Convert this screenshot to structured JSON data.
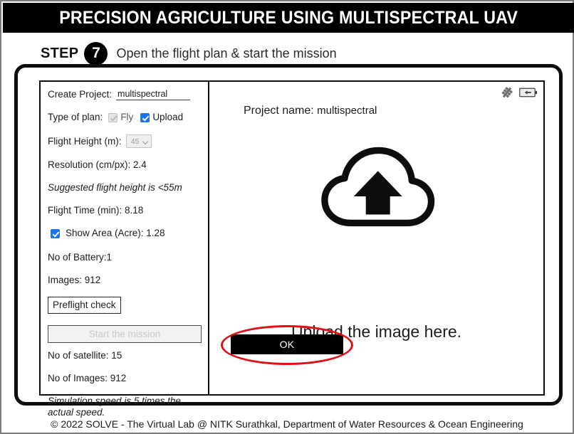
{
  "header": {
    "title": "PRECISION AGRICULTURE USING MULTISPECTRAL UAV"
  },
  "step": {
    "word": "STEP",
    "number": "7",
    "description": "Open the flight plan & start the mission"
  },
  "left_panel": {
    "create_project_label": "Create Project:",
    "project_name_value": "multispectral",
    "project_name_placeholder": "Project name",
    "type_of_plan_label": "Type of plan:",
    "fly_label": "Fly",
    "fly_checked": true,
    "fly_disabled": true,
    "upload_label": "Upload",
    "upload_checked": true,
    "flight_height_label": "Flight Height (m):",
    "flight_height_value": "45",
    "flight_height_options": [
      "45"
    ],
    "resolution_label": "Resolution (cm/px): 2.4",
    "suggested_height_note": "Suggested flight height is <55m",
    "flight_time_label": "Flight Time (min): 8.18",
    "show_area_label": "Show Area (Acre): 1.28",
    "show_area_checked": true,
    "no_of_battery_label": "No of Battery:1",
    "images_label": "Images: 912",
    "preflight_check_button": "Preflight check",
    "start_mission_button": "Start the mission",
    "start_mission_disabled": true,
    "no_of_satellite_label": "No of satellite: 15",
    "no_of_images_label": "No of Images: 912",
    "simulation_note": "Simulation speed is 5 times the actual speed."
  },
  "right_panel": {
    "project_name_label": "Project name:",
    "project_name_value": "multispectral",
    "upload_prompt": "Upload the image here.",
    "ok_button": "OK",
    "satellite_icon": "satellite-icon",
    "battery_icon": "battery-icon",
    "cloud_upload_icon": "cloud-upload-icon"
  },
  "annotation": {
    "highlight_color": "#e10f16",
    "target": "ok-button"
  },
  "footer": {
    "text": "© 2022 SOLVE - The Virtual Lab @ NITK Surathkal, Department of Water Resources & Ocean Engineering"
  }
}
